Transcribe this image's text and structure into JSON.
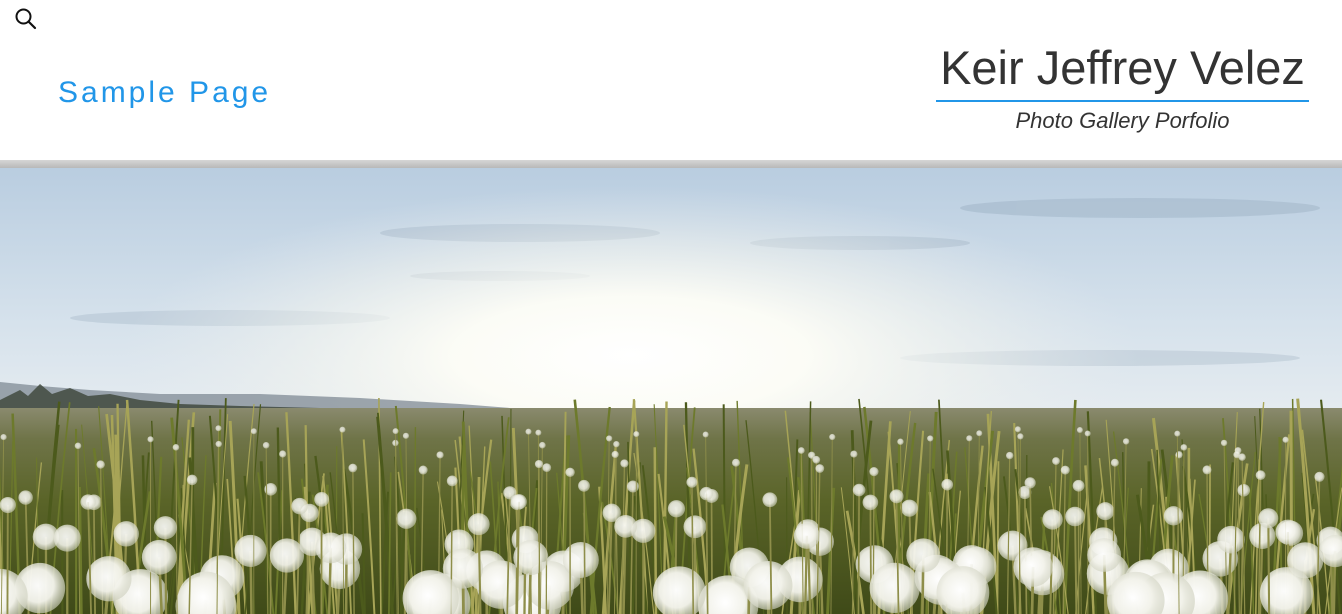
{
  "header": {
    "search_icon": "search-icon",
    "nav": {
      "sample_page_label": "Sample Page"
    },
    "site_title": "Keir Jeffrey Velez",
    "tagline": "Photo Gallery Porfolio"
  },
  "hero": {
    "subject": "dandelion-field-at-sunrise"
  },
  "colors": {
    "accent": "#2196e8",
    "title_text": "#333333",
    "background": "#ffffff"
  }
}
